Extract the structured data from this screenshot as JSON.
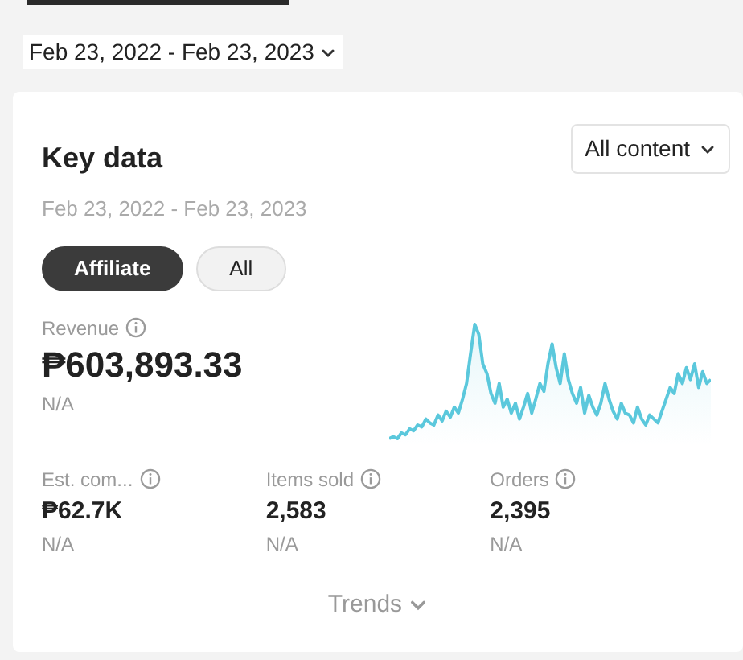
{
  "date_range_dropdown": {
    "label": "Feb 23, 2022 - Feb 23, 2023"
  },
  "key_data": {
    "title": "Key data",
    "content_dropdown": {
      "label": "All content"
    },
    "date_range": "Feb 23, 2022 - Feb 23, 2023",
    "filters": [
      {
        "label": "Affiliate",
        "selected": true
      },
      {
        "label": "All",
        "selected": false
      }
    ],
    "revenue": {
      "label": "Revenue",
      "value": "₱603,893.33",
      "change": "N/A"
    },
    "metrics": [
      {
        "label": "Est. com...",
        "value": "₱62.7K",
        "change": "N/A"
      },
      {
        "label": "Items sold",
        "value": "2,583",
        "change": "N/A"
      },
      {
        "label": "Orders",
        "value": "2,395",
        "change": "N/A"
      }
    ],
    "trends_toggle": {
      "label": "Trends",
      "expanded": false
    }
  }
}
